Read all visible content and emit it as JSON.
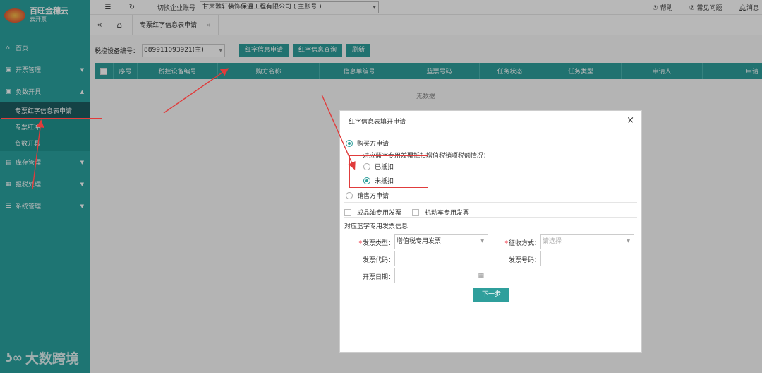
{
  "sidebar": {
    "logo_title": "百旺金穗云",
    "logo_sub": "云开票",
    "items": [
      {
        "label": "首页",
        "icon": "home-icon"
      },
      {
        "label": "开票管理",
        "icon": "invoice-icon"
      },
      {
        "label": "负数开具",
        "icon": "negative-icon"
      },
      {
        "label": "库存管理",
        "icon": "stock-icon"
      },
      {
        "label": "报税处理",
        "icon": "tax-icon"
      },
      {
        "label": "系统管理",
        "icon": "settings-icon"
      }
    ],
    "sub_items": [
      "专票红字信息表申请",
      "专票红冲",
      "负数开具"
    ]
  },
  "topbar": {
    "switch_label": "切换企业账号",
    "company": "甘肃雅轩装饰保温工程有限公司 ( 主账号 )",
    "help": "帮助",
    "faq": "常见问题",
    "messages": "消息"
  },
  "tabs": {
    "active": "专票红字信息表申请"
  },
  "toolbar": {
    "device_label": "税控设备编号：",
    "device_value": "889911093921(主)",
    "btn_apply": "红字信息申请",
    "btn_query": "红字信息查询",
    "btn_refresh": "刷新"
  },
  "grid": {
    "columns": [
      "序号",
      "税控设备编号",
      "购方名称",
      "信息单编号",
      "蓝票号码",
      "任务状态",
      "任务类型",
      "申请人",
      "申请"
    ],
    "empty_text": "无数据"
  },
  "modal": {
    "title": "红字信息表填开申请",
    "buyer_apply": "购买方申请",
    "deduct_question": "对应蓝字专用发票抵扣增值税销项税额情况：",
    "deducted": "已抵扣",
    "not_deducted": "未抵扣",
    "seller_apply": "销售方申请",
    "refined_oil": "成品油专用发票",
    "motor_vehicle": "机动车专用发票",
    "section_title": "对应蓝字专用发票信息",
    "invoice_type_label": "发票类型：",
    "invoice_type_value": "增值税专用发票",
    "collect_method_label": "征收方式：",
    "collect_method_placeholder": "请选择",
    "invoice_code_label": "发票代码：",
    "invoice_number_label": "发票号码：",
    "issue_date_label": "开票日期：",
    "next_button": "下一步"
  },
  "watermark": "大数跨境"
}
